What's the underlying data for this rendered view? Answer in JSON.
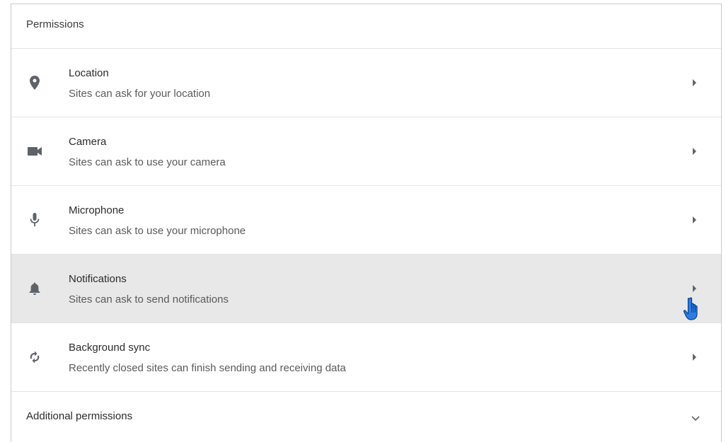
{
  "permissions": {
    "title": "Permissions",
    "items": [
      {
        "icon": "location-icon",
        "title": "Location",
        "subtitle": "Sites can ask for your location"
      },
      {
        "icon": "camera-icon",
        "title": "Camera",
        "subtitle": "Sites can ask to use your camera"
      },
      {
        "icon": "microphone-icon",
        "title": "Microphone",
        "subtitle": "Sites can ask to use your microphone"
      },
      {
        "icon": "notifications-bell-icon",
        "title": "Notifications",
        "subtitle": "Sites can ask to send notifications"
      },
      {
        "icon": "background-sync-icon",
        "title": "Background sync",
        "subtitle": "Recently closed sites can finish sending and receiving data"
      }
    ],
    "hovered_item": "Notifications",
    "additional_label": "Additional permissions"
  },
  "colors": {
    "icon": "#5f6368",
    "hover_row": "#e8e8e8",
    "border": "#e4e4e4",
    "cursor": "#1a73e8"
  }
}
